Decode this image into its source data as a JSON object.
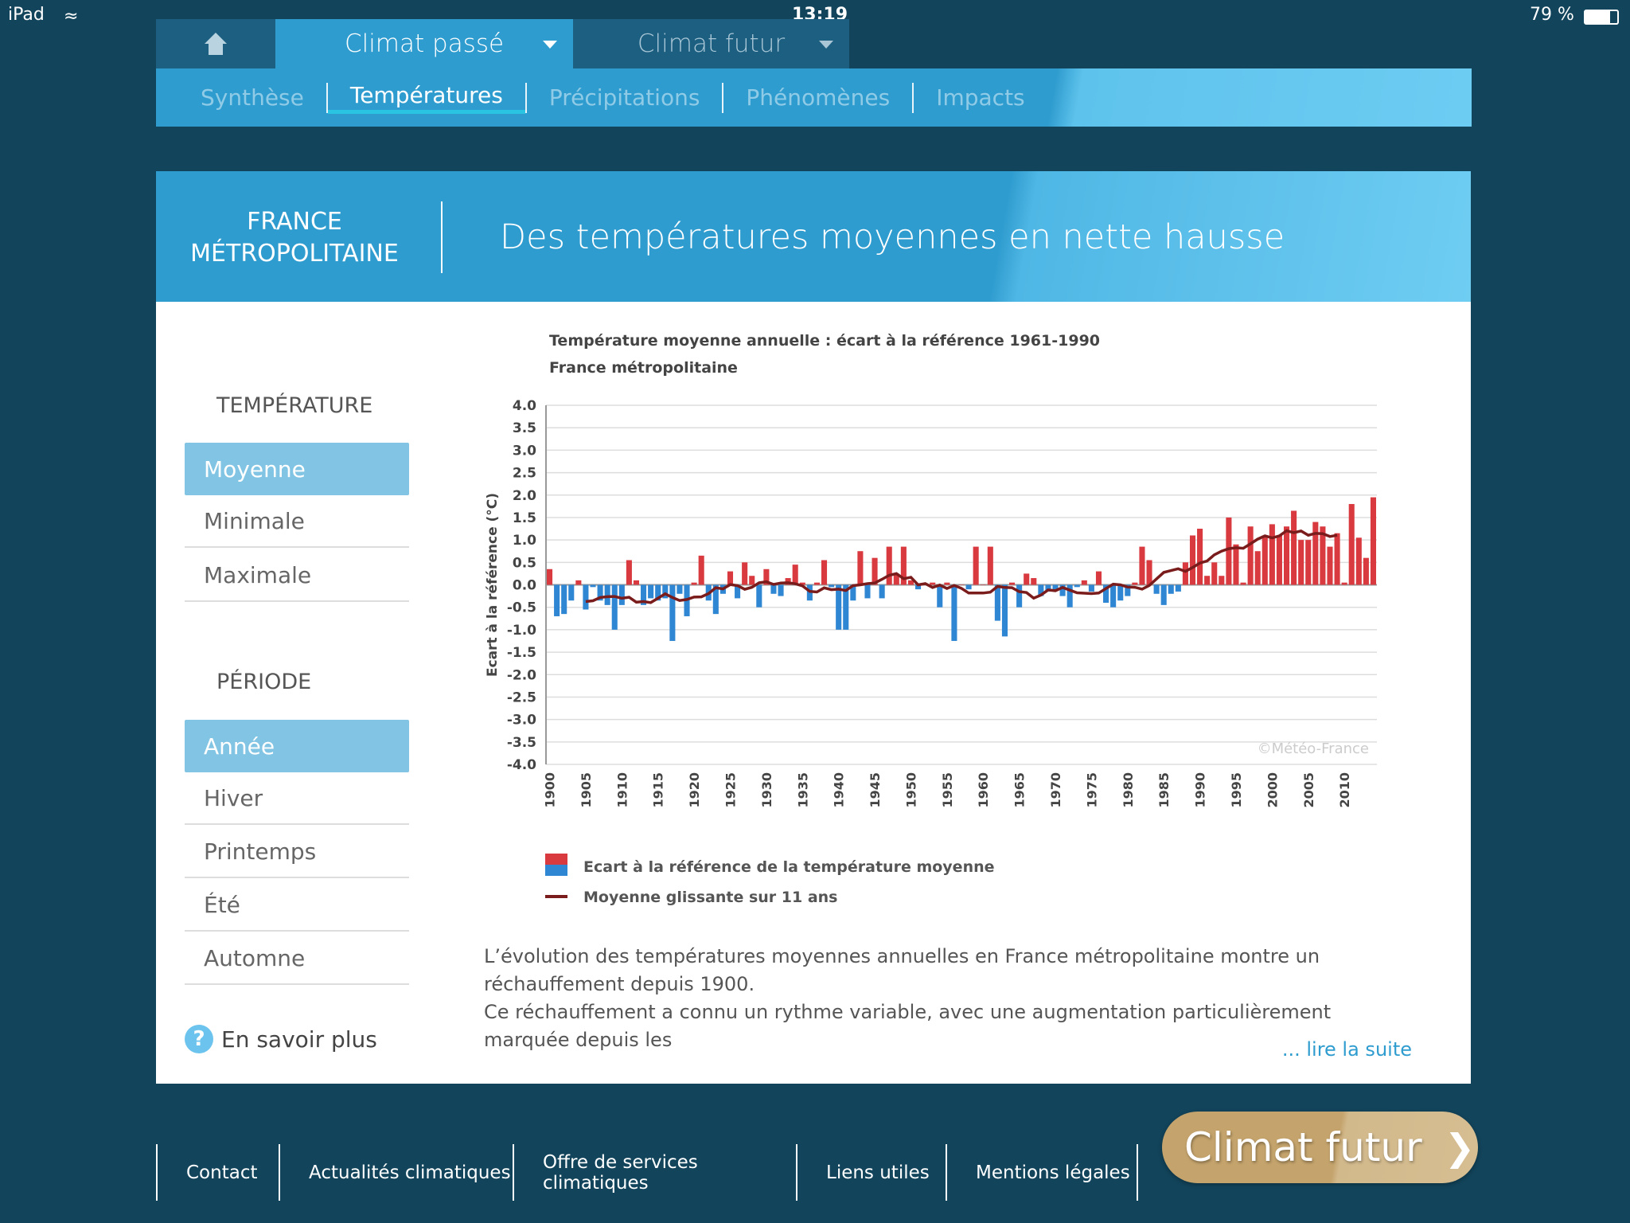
{
  "status_bar": {
    "device": "iPad",
    "time": "13:19",
    "battery": "79 %"
  },
  "top_nav": {
    "home_icon": "home-icon",
    "tabs": [
      {
        "label": "Climat passé",
        "active": true
      },
      {
        "label": "Climat futur",
        "active": false
      }
    ]
  },
  "sub_nav": {
    "items": [
      "Synthèse",
      "Températures",
      "Précipitations",
      "Phénomènes",
      "Impacts"
    ],
    "active": "Températures"
  },
  "header": {
    "region_line1": "FRANCE",
    "region_line2": "MÉTROPOLITAINE",
    "title": "Des températures moyennes en nette hausse"
  },
  "sidebar": {
    "temperature_heading": "TEMPÉRATURE",
    "temperature_items": [
      "Moyenne",
      "Minimale",
      "Maximale"
    ],
    "temperature_selected": "Moyenne",
    "period_heading": "PÉRIODE",
    "period_items": [
      "Année",
      "Hiver",
      "Printemps",
      "Été",
      "Automne"
    ],
    "period_selected": "Année",
    "more_label": "En savoir plus"
  },
  "chart_data": {
    "type": "bar",
    "title": "Température moyenne annuelle : écart à la référence 1961-1990",
    "subtitle": "France métropolitaine",
    "ylabel": "Ecart à la référence (°C)",
    "ylim": [
      -4.0,
      4.0
    ],
    "yticks": [
      "4.0",
      "3.5",
      "3.0",
      "2.5",
      "2.0",
      "1.5",
      "1.0",
      "0.5",
      "0.0",
      "-0.5",
      "-1.0",
      "-1.5",
      "-2.0",
      "-2.5",
      "-3.0",
      "-3.5",
      "-4.0"
    ],
    "xticks": [
      "1900",
      "1905",
      "1910",
      "1915",
      "1920",
      "1925",
      "1930",
      "1935",
      "1940",
      "1945",
      "1950",
      "1955",
      "1960",
      "1965",
      "1970",
      "1975",
      "1980",
      "1985",
      "1990",
      "1995",
      "2000",
      "2005",
      "2010"
    ],
    "grid": true,
    "watermark": "©Météo-France",
    "x_start": 1900,
    "values": [
      0.35,
      -0.7,
      -0.65,
      -0.35,
      0.1,
      -0.55,
      -0.05,
      -0.35,
      -0.45,
      -1.0,
      -0.45,
      0.55,
      0.1,
      -0.45,
      -0.3,
      -0.35,
      -0.3,
      -1.25,
      -0.2,
      -0.7,
      0.05,
      0.65,
      -0.35,
      -0.65,
      -0.2,
      0.3,
      -0.3,
      0.5,
      0.2,
      -0.5,
      0.35,
      -0.2,
      -0.25,
      0.15,
      0.45,
      0.05,
      -0.35,
      0.05,
      0.55,
      -0.05,
      -1.0,
      -1.0,
      -0.35,
      0.75,
      -0.3,
      0.6,
      -0.3,
      0.85,
      0.25,
      0.85,
      0.1,
      -0.1,
      0.0,
      0.05,
      -0.5,
      0.05,
      -1.25,
      0.0,
      -0.1,
      0.85,
      0.0,
      0.85,
      -0.8,
      -1.15,
      0.05,
      -0.5,
      0.25,
      0.15,
      -0.25,
      -0.15,
      -0.1,
      -0.25,
      -0.5,
      -0.05,
      0.1,
      -0.15,
      0.3,
      -0.4,
      -0.5,
      -0.35,
      -0.25,
      0.05,
      0.85,
      0.55,
      -0.2,
      -0.45,
      -0.2,
      -0.15,
      0.5,
      1.1,
      1.25,
      0.2,
      0.5,
      0.2,
      1.5,
      0.9,
      0.05,
      1.3,
      0.75,
      1.1,
      1.35,
      1.1,
      1.3,
      1.65,
      1.0,
      1.0,
      1.4,
      1.3,
      0.85,
      1.15,
      0.05,
      1.8,
      1.05,
      0.6,
      1.95
    ],
    "colors": {
      "positive": "#d93a40",
      "negative": "#2f86d2",
      "moving_average": "#7a1c1c"
    },
    "legend": [
      {
        "label": "Ecart à la référence de la température moyenne"
      },
      {
        "label": "Moyenne glissante sur 11 ans"
      }
    ],
    "legend_position": "bottom-left"
  },
  "description": {
    "line1": "L’évolution des températures moyennes annuelles en France métropolitaine montre un réchauffement depuis 1900.",
    "line2": "Ce réchauffement a connu un rythme variable, avec une augmentation particulièrement marquée depuis les",
    "read_more": "... lire la suite"
  },
  "footer": {
    "links": [
      "Contact",
      "Actualités climatiques",
      "Offre de services climatiques",
      "Liens utiles",
      "Mentions légales"
    ],
    "cta_label": "Climat futur"
  }
}
